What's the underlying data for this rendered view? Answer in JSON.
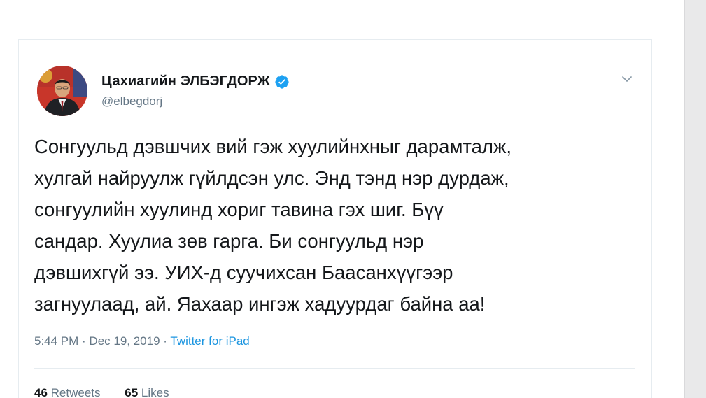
{
  "tweet": {
    "author": {
      "name": "Цахиагийн ЭЛБЭГДОРЖ",
      "handle": "@elbegdorj",
      "verified": true,
      "avatar_icon": "profile-photo"
    },
    "text": "Сонгуульд дэвшчих вий гэж хуулийнхныг дарамталж,\nхулгай найруулж гүйлдсэн улс. Энд тэнд нэр дурдаж,\nсонгуулийн хуулинд хориг тавина гэх шиг. Бүү\nсандар. Хуулиа зөв гарга. Би сонгуульд нэр\nдэвшихгүй ээ. УИХ-д суучихсан Баасанхүүгээр\nзагнуулаад, ай. Яахаар ингэж хадуурдаг байна аа!",
    "timestamp": "5:44 PM · Dec 19, 2019 · ",
    "source": "Twitter for iPad",
    "retweets_count": "46",
    "retweets_label": "Retweets",
    "likes_count": "65",
    "likes_label": "Likes"
  },
  "colors": {
    "text_primary": "#14171a",
    "text_secondary": "#657786",
    "link": "#1b95e0",
    "verified": "#1da1f2",
    "divider": "#e6ecf0"
  }
}
